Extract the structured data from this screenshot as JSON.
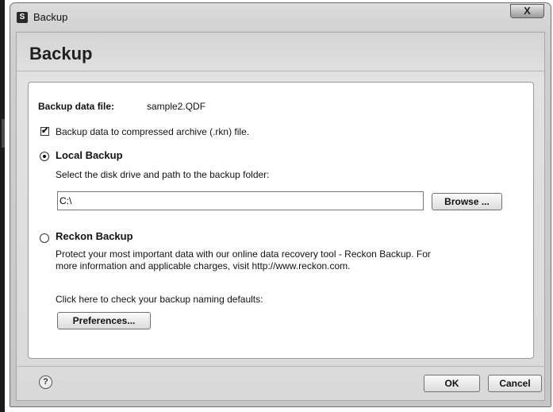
{
  "window": {
    "app_icon_letter": "S",
    "title": "Backup",
    "close_glyph": "X"
  },
  "header": {
    "title": "Backup"
  },
  "backup_file": {
    "label": "Backup data file:",
    "value": "sample2.QDF"
  },
  "compress": {
    "checked": true,
    "check_glyph": "✔",
    "label": "Backup data to compressed archive (.rkn) file."
  },
  "local_backup": {
    "selected": true,
    "label": "Local Backup",
    "description": "Select the disk drive and path to the backup folder:",
    "path_value": "C:\\",
    "browse_label": "Browse ..."
  },
  "reckon_backup": {
    "selected": false,
    "label": "Reckon Backup",
    "description_line1": "Protect your most important data with our online data recovery tool - Reckon Backup.  For",
    "description_line2": "more information and applicable charges, visit http://www.reckon.com."
  },
  "naming": {
    "text": "Click here to check your backup naming defaults:",
    "preferences_label": "Preferences..."
  },
  "footer": {
    "help_glyph": "?",
    "ok_label": "OK",
    "cancel_label": "Cancel"
  }
}
